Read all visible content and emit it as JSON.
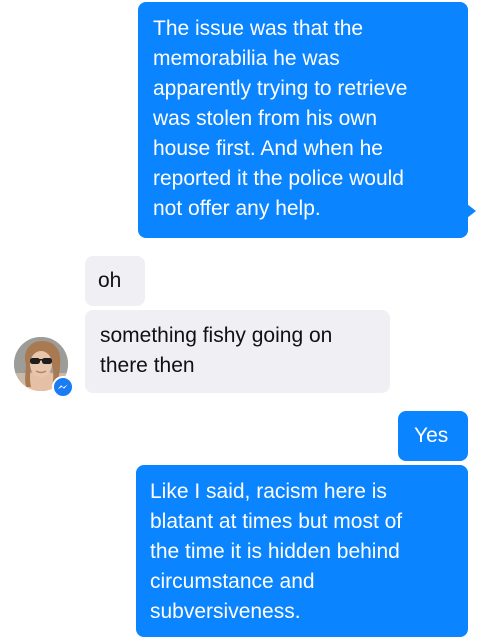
{
  "conversation": {
    "messages": [
      {
        "direction": "outgoing",
        "text": "The issue was that the\nmemorabilia he was\napparently trying to retrieve\nwas stolen from his own\nhouse first. And when he\nreported it the police would\nnot offer any help."
      },
      {
        "direction": "incoming",
        "text": "oh"
      },
      {
        "direction": "incoming",
        "text": "something fishy going on\nthere then"
      },
      {
        "direction": "outgoing",
        "text": "Yes"
      },
      {
        "direction": "outgoing",
        "text": "Like I said, racism here is\nblatant at times but most of\nthe time it is hidden behind\ncircumstance and\nsubversiveness."
      }
    ],
    "contact": {
      "avatar_icon": "profile-photo",
      "badge_icon": "messenger-icon"
    }
  },
  "colors": {
    "outgoing_bubble": "#0a84ff",
    "incoming_bubble": "#f0eff4",
    "messenger_badge": "#1a7cf2"
  }
}
